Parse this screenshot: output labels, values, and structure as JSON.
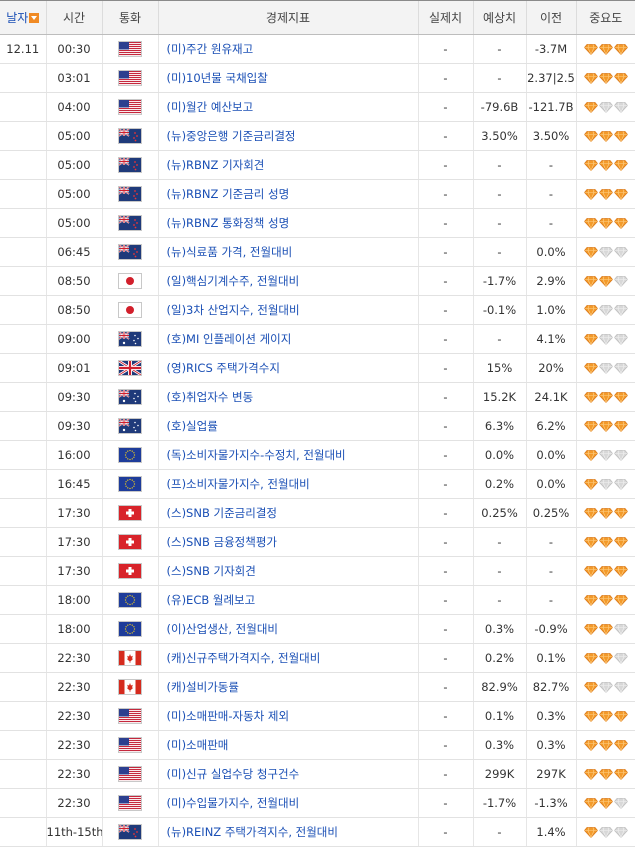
{
  "headers": {
    "date": "날자",
    "time": "시간",
    "currency": "통화",
    "indicator": "경제지표",
    "actual": "실제치",
    "forecast": "예상치",
    "previous": "이전",
    "importance": "중요도"
  },
  "colors": {
    "gem_active": "#f39a2a",
    "gem_inactive": "#d8d8d8",
    "indicator_link": "#1a4fb5"
  },
  "rows": [
    {
      "date": "12.11",
      "time": "00:30",
      "flag": "us-flag-icon",
      "indicator": "(미)주간 원유재고",
      "actual": "-",
      "forecast": "-",
      "previous": "-3.7M",
      "importance": 3
    },
    {
      "date": "",
      "time": "03:01",
      "flag": "us-flag-icon",
      "indicator": "(미)10년물 국채입찰",
      "actual": "-",
      "forecast": "-",
      "previous": "2.37|2.5",
      "importance": 3
    },
    {
      "date": "",
      "time": "04:00",
      "flag": "us-flag-icon",
      "indicator": "(미)월간 예산보고",
      "actual": "-",
      "forecast": "-79.6B",
      "previous": "-121.7B",
      "importance": 1
    },
    {
      "date": "",
      "time": "05:00",
      "flag": "nz-flag-icon",
      "indicator": "(뉴)중앙은행 기준금리결정",
      "actual": "-",
      "forecast": "3.50%",
      "previous": "3.50%",
      "importance": 3
    },
    {
      "date": "",
      "time": "05:00",
      "flag": "nz-flag-icon",
      "indicator": "(뉴)RBNZ 기자회견",
      "actual": "-",
      "forecast": "-",
      "previous": "-",
      "importance": 3
    },
    {
      "date": "",
      "time": "05:00",
      "flag": "nz-flag-icon",
      "indicator": "(뉴)RBNZ 기준금리 성명",
      "actual": "-",
      "forecast": "-",
      "previous": "-",
      "importance": 3
    },
    {
      "date": "",
      "time": "05:00",
      "flag": "nz-flag-icon",
      "indicator": "(뉴)RBNZ 통화정책 성명",
      "actual": "-",
      "forecast": "-",
      "previous": "-",
      "importance": 3
    },
    {
      "date": "",
      "time": "06:45",
      "flag": "nz-flag-icon",
      "indicator": "(뉴)식료품 가격, 전월대비",
      "actual": "-",
      "forecast": "-",
      "previous": "0.0%",
      "importance": 1
    },
    {
      "date": "",
      "time": "08:50",
      "flag": "jp-flag-icon",
      "indicator": "(일)핵심기계수주, 전월대비",
      "actual": "-",
      "forecast": "-1.7%",
      "previous": "2.9%",
      "importance": 2
    },
    {
      "date": "",
      "time": "08:50",
      "flag": "jp-flag-icon",
      "indicator": "(일)3차 산업지수, 전월대비",
      "actual": "-",
      "forecast": "-0.1%",
      "previous": "1.0%",
      "importance": 1
    },
    {
      "date": "",
      "time": "09:00",
      "flag": "au-flag-icon",
      "indicator": "(호)MI 인플레이션 게이지",
      "actual": "-",
      "forecast": "-",
      "previous": "4.1%",
      "importance": 1
    },
    {
      "date": "",
      "time": "09:01",
      "flag": "uk-flag-icon",
      "indicator": "(영)RICS 주택가격수지",
      "actual": "-",
      "forecast": "15%",
      "previous": "20%",
      "importance": 1
    },
    {
      "date": "",
      "time": "09:30",
      "flag": "au-flag-icon",
      "indicator": "(호)취업자수 변동",
      "actual": "-",
      "forecast": "15.2K",
      "previous": "24.1K",
      "importance": 3
    },
    {
      "date": "",
      "time": "09:30",
      "flag": "au-flag-icon",
      "indicator": "(호)실업률",
      "actual": "-",
      "forecast": "6.3%",
      "previous": "6.2%",
      "importance": 3
    },
    {
      "date": "",
      "time": "16:00",
      "flag": "eu-flag-icon",
      "indicator": "(독)소비자물가지수-수정치, 전월대비",
      "actual": "-",
      "forecast": "0.0%",
      "previous": "0.0%",
      "importance": 1
    },
    {
      "date": "",
      "time": "16:45",
      "flag": "eu-flag-icon",
      "indicator": "(프)소비자물가지수, 전월대비",
      "actual": "-",
      "forecast": "0.2%",
      "previous": "0.0%",
      "importance": 1
    },
    {
      "date": "",
      "time": "17:30",
      "flag": "ch-flag-icon",
      "indicator": "(스)SNB 기준금리결정",
      "actual": "-",
      "forecast": "0.25%",
      "previous": "0.25%",
      "importance": 3
    },
    {
      "date": "",
      "time": "17:30",
      "flag": "ch-flag-icon",
      "indicator": "(스)SNB 금융정책평가",
      "actual": "-",
      "forecast": "-",
      "previous": "-",
      "importance": 3
    },
    {
      "date": "",
      "time": "17:30",
      "flag": "ch-flag-icon",
      "indicator": "(스)SNB 기자회견",
      "actual": "-",
      "forecast": "-",
      "previous": "-",
      "importance": 3
    },
    {
      "date": "",
      "time": "18:00",
      "flag": "eu-flag-icon",
      "indicator": "(유)ECB 월례보고",
      "actual": "-",
      "forecast": "-",
      "previous": "-",
      "importance": 3
    },
    {
      "date": "",
      "time": "18:00",
      "flag": "eu-flag-icon",
      "indicator": "(이)산업생산, 전월대비",
      "actual": "-",
      "forecast": "0.3%",
      "previous": "-0.9%",
      "importance": 2
    },
    {
      "date": "",
      "time": "22:30",
      "flag": "ca-flag-icon",
      "indicator": "(캐)신규주택가격지수, 전월대비",
      "actual": "-",
      "forecast": "0.2%",
      "previous": "0.1%",
      "importance": 2
    },
    {
      "date": "",
      "time": "22:30",
      "flag": "ca-flag-icon",
      "indicator": "(캐)설비가동률",
      "actual": "-",
      "forecast": "82.9%",
      "previous": "82.7%",
      "importance": 1
    },
    {
      "date": "",
      "time": "22:30",
      "flag": "us-flag-icon",
      "indicator": "(미)소매판매-자동차 제외",
      "actual": "-",
      "forecast": "0.1%",
      "previous": "0.3%",
      "importance": 3
    },
    {
      "date": "",
      "time": "22:30",
      "flag": "us-flag-icon",
      "indicator": "(미)소매판매",
      "actual": "-",
      "forecast": "0.3%",
      "previous": "0.3%",
      "importance": 3
    },
    {
      "date": "",
      "time": "22:30",
      "flag": "us-flag-icon",
      "indicator": "(미)신규 실업수당 청구건수",
      "actual": "-",
      "forecast": "299K",
      "previous": "297K",
      "importance": 3
    },
    {
      "date": "",
      "time": "22:30",
      "flag": "us-flag-icon",
      "indicator": "(미)수입물가지수, 전월대비",
      "actual": "-",
      "forecast": "-1.7%",
      "previous": "-1.3%",
      "importance": 2
    },
    {
      "date": "",
      "time": "11th-15th",
      "flag": "nz-flag-icon",
      "indicator": "(뉴)REINZ 주택가격지수, 전월대비",
      "actual": "-",
      "forecast": "-",
      "previous": "1.4%",
      "importance": 1
    }
  ]
}
